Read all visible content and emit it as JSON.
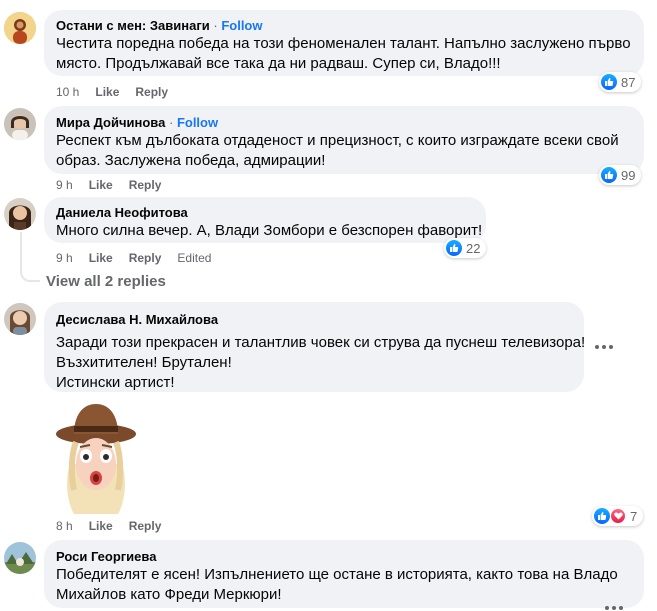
{
  "comments": [
    {
      "author": "Остани с мен: Завинаги",
      "follow": "Follow",
      "lines": [
        "Честита поредна победа на този феноменален талант. Напълно заслужено първо",
        "място. Продължавай все така да ни радваш. Супер си, Владо!!!"
      ],
      "time": "10 h",
      "like": "Like",
      "reply": "Reply",
      "reaction_count": "87"
    },
    {
      "author": "Мира Дойчинова",
      "follow": "Follow",
      "lines": [
        "Респект към дълбоката отдаденост и прецизност, с които изграждате всеки свой",
        "образ. Заслужена победа, адмирации!"
      ],
      "time": "9 h",
      "like": "Like",
      "reply": "Reply",
      "reaction_count": "99"
    },
    {
      "author": "Даниела Неофитова",
      "lines": [
        "Много силна вечер. А, Влади Зомбори е безспорен фаворит!"
      ],
      "time": "9 h",
      "like": "Like",
      "reply": "Reply",
      "edited": "Edited",
      "reaction_count": "22"
    },
    {
      "author": "Десислава Н. Михайлова",
      "lines": [
        "Заради този прекрасен и талантлив човек си струва да пуснеш телевизора!",
        "Възхитителен! Брутален!",
        "Истински артист!"
      ],
      "time": "8 h",
      "like": "Like",
      "reply": "Reply",
      "reaction_count": "7"
    },
    {
      "author": "Роси Георгиева",
      "lines": [
        "Победителят е ясен! Изпълнението ще остане в историята, както това на Владо",
        "Михайлов като Фреди Меркюри!"
      ]
    }
  ],
  "view_replies": "View all 2 replies",
  "colors": {
    "bubble": "#f0f2f5",
    "meta": "#65676b",
    "follow": "#1877f2",
    "like": "#0866ff",
    "love": "#e61e4d"
  },
  "icons": {
    "like": "thumbs-up-icon",
    "love": "heart-icon",
    "more": "more-options-icon"
  }
}
